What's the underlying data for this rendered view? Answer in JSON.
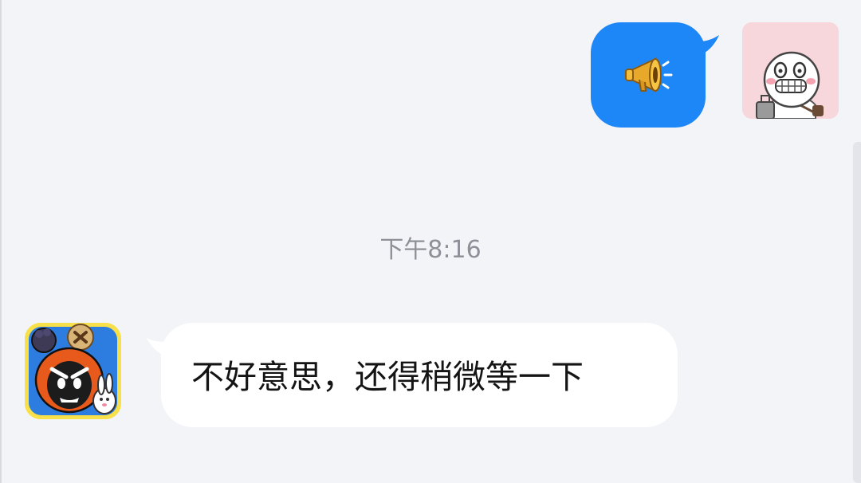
{
  "chat": {
    "timestamp": "下午8:16",
    "messages": [
      {
        "direction": "outgoing",
        "type": "sticker",
        "sticker_icon": "megaphone-icon",
        "bubble_color": "#1e87f8",
        "avatar": "cartoon-character-avatar"
      },
      {
        "direction": "incoming",
        "type": "text",
        "text": "不好意思，还得稍微等一下",
        "bubble_color": "#ffffff",
        "avatar": "game-character-avatar"
      }
    ]
  },
  "colors": {
    "background": "#f3f4f8",
    "timestamp_text": "#8e9098",
    "message_text": "#141414"
  }
}
